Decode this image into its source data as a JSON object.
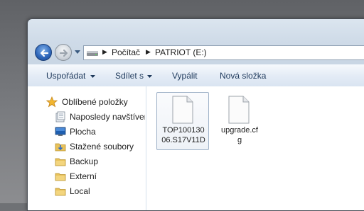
{
  "address_bar": {
    "crumbs": [
      "Počítač",
      "PATRIOT (E:)"
    ]
  },
  "toolbar": {
    "organize_label": "Uspořádat",
    "share_label": "Sdílet s",
    "burn_label": "Vypálit",
    "new_folder_label": "Nová složka"
  },
  "nav_pane": {
    "favorites_label": "Oblíbené položky",
    "items": [
      {
        "label": "Naposledy navštíver",
        "icon": "recent-places-icon"
      },
      {
        "label": "Plocha",
        "icon": "desktop-icon"
      },
      {
        "label": "Stažené soubory",
        "icon": "downloads-folder-icon"
      },
      {
        "label": "Backup",
        "icon": "folder-icon"
      },
      {
        "label": "Externí",
        "icon": "folder-icon"
      },
      {
        "label": "Local",
        "icon": "folder-icon"
      }
    ]
  },
  "files": [
    {
      "name": "TOP10013006.S17V11D",
      "line1": "TOP100130",
      "line2": "06.S17V11D",
      "selected": true,
      "icon": "file-icon"
    },
    {
      "name": "upgrade.cfg",
      "line1": "upgrade.cf",
      "line2": "g",
      "selected": false,
      "icon": "file-icon"
    }
  ],
  "colors": {
    "back_button": "#2c64b8",
    "toolbar_text": "#1e395b",
    "favorites_star": "#f2b630",
    "folder": "#e8c25a"
  }
}
